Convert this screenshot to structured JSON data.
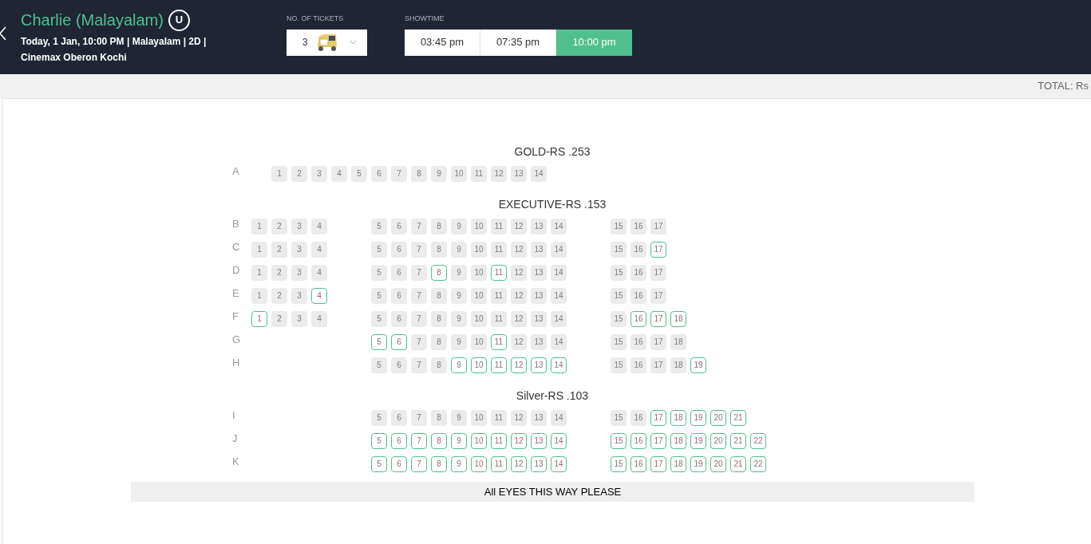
{
  "movie": {
    "title": "Charlie (Malayalam)",
    "rating": "U",
    "details": "Today, 1 Jan, 10:00 PM | Malayalam | 2D |",
    "venue": "Cinemax Oberon Kochi"
  },
  "tickets": {
    "label": "NO. OF TICKETS",
    "value": "3"
  },
  "showtimes": {
    "label": "SHOWTIME",
    "items": [
      {
        "time": "03:45 pm",
        "selected": false
      },
      {
        "time": "07:35 pm",
        "selected": false
      },
      {
        "time": "10:00 pm",
        "selected": true
      }
    ]
  },
  "total": {
    "label": "TOTAL: Rs"
  },
  "sections": [
    {
      "title": "GOLD-RS .253",
      "rows": [
        {
          "row": "A",
          "seats": [
            {
              "n": "1",
              "available": false
            },
            {
              "n": "2",
              "available": false
            },
            {
              "n": "3",
              "available": false
            },
            {
              "n": "4",
              "available": false
            },
            {
              "n": "5",
              "available": false
            },
            {
              "n": "6",
              "available": false
            },
            {
              "n": "7",
              "available": false
            },
            {
              "n": "8",
              "available": false
            },
            {
              "n": "9",
              "available": false
            },
            {
              "n": "10",
              "available": false
            },
            {
              "n": "11",
              "available": false
            },
            {
              "n": "12",
              "available": false
            },
            {
              "n": "13",
              "available": false
            },
            {
              "n": "14",
              "available": false
            }
          ]
        }
      ]
    },
    {
      "title": "EXECUTIVE-RS .153",
      "rows": [
        {
          "row": "B",
          "seats": [
            {
              "n": "1",
              "available": false
            },
            {
              "n": "2",
              "available": false
            },
            {
              "n": "3",
              "available": false
            },
            {
              "n": "4",
              "available": false
            },
            {
              "n": "5",
              "available": false
            },
            {
              "n": "6",
              "available": false
            },
            {
              "n": "7",
              "available": false
            },
            {
              "n": "8",
              "available": false
            },
            {
              "n": "9",
              "available": false
            },
            {
              "n": "10",
              "available": false
            },
            {
              "n": "11",
              "available": false
            },
            {
              "n": "12",
              "available": false
            },
            {
              "n": "13",
              "available": false
            },
            {
              "n": "14",
              "available": false
            },
            {
              "n": "15",
              "available": false
            },
            {
              "n": "16",
              "available": false
            },
            {
              "n": "17",
              "available": false
            }
          ]
        },
        {
          "row": "C",
          "seats": [
            {
              "n": "1",
              "available": false
            },
            {
              "n": "2",
              "available": false
            },
            {
              "n": "3",
              "available": false
            },
            {
              "n": "4",
              "available": false
            },
            {
              "n": "5",
              "available": false
            },
            {
              "n": "6",
              "available": false
            },
            {
              "n": "7",
              "available": false
            },
            {
              "n": "8",
              "available": false
            },
            {
              "n": "9",
              "available": false
            },
            {
              "n": "10",
              "available": false
            },
            {
              "n": "11",
              "available": false
            },
            {
              "n": "12",
              "available": false
            },
            {
              "n": "13",
              "available": false
            },
            {
              "n": "14",
              "available": false
            },
            {
              "n": "15",
              "available": false
            },
            {
              "n": "16",
              "available": false
            },
            {
              "n": "17",
              "available": true
            }
          ]
        },
        {
          "row": "D",
          "seats": [
            {
              "n": "1",
              "available": false
            },
            {
              "n": "2",
              "available": false
            },
            {
              "n": "3",
              "available": false
            },
            {
              "n": "4",
              "available": false
            },
            {
              "n": "5",
              "available": false
            },
            {
              "n": "6",
              "available": false
            },
            {
              "n": "7",
              "available": false
            },
            {
              "n": "8",
              "available": true
            },
            {
              "n": "9",
              "available": false
            },
            {
              "n": "10",
              "available": false
            },
            {
              "n": "11",
              "available": true
            },
            {
              "n": "12",
              "available": false
            },
            {
              "n": "13",
              "available": false
            },
            {
              "n": "14",
              "available": false
            },
            {
              "n": "15",
              "available": false
            },
            {
              "n": "16",
              "available": false
            },
            {
              "n": "17",
              "available": false
            }
          ]
        },
        {
          "row": "E",
          "seats": [
            {
              "n": "1",
              "available": false
            },
            {
              "n": "2",
              "available": false
            },
            {
              "n": "3",
              "available": false
            },
            {
              "n": "4",
              "available": true
            },
            {
              "n": "5",
              "available": false
            },
            {
              "n": "6",
              "available": false
            },
            {
              "n": "7",
              "available": false
            },
            {
              "n": "8",
              "available": false
            },
            {
              "n": "9",
              "available": false
            },
            {
              "n": "10",
              "available": false
            },
            {
              "n": "11",
              "available": false
            },
            {
              "n": "12",
              "available": false
            },
            {
              "n": "13",
              "available": false
            },
            {
              "n": "14",
              "available": false
            },
            {
              "n": "15",
              "available": false
            },
            {
              "n": "16",
              "available": false
            },
            {
              "n": "17",
              "available": false
            }
          ]
        },
        {
          "row": "F",
          "seats": [
            {
              "n": "1",
              "available": true
            },
            {
              "n": "2",
              "available": false
            },
            {
              "n": "3",
              "available": false
            },
            {
              "n": "4",
              "available": false
            },
            {
              "n": "5",
              "available": false
            },
            {
              "n": "6",
              "available": false
            },
            {
              "n": "7",
              "available": false
            },
            {
              "n": "8",
              "available": false
            },
            {
              "n": "9",
              "available": false
            },
            {
              "n": "10",
              "available": false
            },
            {
              "n": "11",
              "available": false
            },
            {
              "n": "12",
              "available": false
            },
            {
              "n": "13",
              "available": false
            },
            {
              "n": "14",
              "available": false
            },
            {
              "n": "15",
              "available": false
            },
            {
              "n": "16",
              "available": true
            },
            {
              "n": "17",
              "available": true
            },
            {
              "n": "18",
              "available": true
            }
          ]
        },
        {
          "row": "G",
          "seats": [
            {
              "n": "5",
              "available": true
            },
            {
              "n": "6",
              "available": true
            },
            {
              "n": "7",
              "available": false
            },
            {
              "n": "8",
              "available": false
            },
            {
              "n": "9",
              "available": false
            },
            {
              "n": "10",
              "available": false
            },
            {
              "n": "11",
              "available": true
            },
            {
              "n": "12",
              "available": false
            },
            {
              "n": "13",
              "available": false
            },
            {
              "n": "14",
              "available": false
            },
            {
              "n": "15",
              "available": false
            },
            {
              "n": "16",
              "available": false
            },
            {
              "n": "17",
              "available": false
            },
            {
              "n": "18",
              "available": false
            }
          ]
        },
        {
          "row": "H",
          "seats": [
            {
              "n": "5",
              "available": false
            },
            {
              "n": "6",
              "available": false
            },
            {
              "n": "7",
              "available": false
            },
            {
              "n": "8",
              "available": false
            },
            {
              "n": "9",
              "available": true
            },
            {
              "n": "10",
              "available": true
            },
            {
              "n": "11",
              "available": true
            },
            {
              "n": "12",
              "available": true
            },
            {
              "n": "13",
              "available": true
            },
            {
              "n": "14",
              "available": true
            },
            {
              "n": "15",
              "available": false
            },
            {
              "n": "16",
              "available": false
            },
            {
              "n": "17",
              "available": false
            },
            {
              "n": "18",
              "available": false
            },
            {
              "n": "19",
              "available": true
            }
          ]
        }
      ]
    },
    {
      "title": "Silver-RS .103",
      "rows": [
        {
          "row": "I",
          "seats": [
            {
              "n": "5",
              "available": false
            },
            {
              "n": "6",
              "available": false
            },
            {
              "n": "7",
              "available": false
            },
            {
              "n": "8",
              "available": false
            },
            {
              "n": "9",
              "available": false
            },
            {
              "n": "10",
              "available": false
            },
            {
              "n": "11",
              "available": false
            },
            {
              "n": "12",
              "available": false
            },
            {
              "n": "13",
              "available": false
            },
            {
              "n": "14",
              "available": false
            },
            {
              "n": "15",
              "available": false
            },
            {
              "n": "16",
              "available": false
            },
            {
              "n": "17",
              "available": true
            },
            {
              "n": "18",
              "available": true
            },
            {
              "n": "19",
              "available": true
            },
            {
              "n": "20",
              "available": true
            },
            {
              "n": "21",
              "available": true
            }
          ]
        },
        {
          "row": "J",
          "seats": [
            {
              "n": "5",
              "available": true
            },
            {
              "n": "6",
              "available": true
            },
            {
              "n": "7",
              "available": true
            },
            {
              "n": "8",
              "available": true
            },
            {
              "n": "9",
              "available": true
            },
            {
              "n": "10",
              "available": true
            },
            {
              "n": "11",
              "available": true
            },
            {
              "n": "12",
              "available": true
            },
            {
              "n": "13",
              "available": true
            },
            {
              "n": "14",
              "available": true
            },
            {
              "n": "15",
              "available": true
            },
            {
              "n": "16",
              "available": true
            },
            {
              "n": "17",
              "available": true
            },
            {
              "n": "18",
              "available": true
            },
            {
              "n": "19",
              "available": true
            },
            {
              "n": "20",
              "available": true
            },
            {
              "n": "21",
              "available": true
            },
            {
              "n": "22",
              "available": true
            }
          ]
        },
        {
          "row": "K",
          "seats": [
            {
              "n": "5",
              "available": true
            },
            {
              "n": "6",
              "available": true
            },
            {
              "n": "7",
              "available": true
            },
            {
              "n": "8",
              "available": true
            },
            {
              "n": "9",
              "available": true
            },
            {
              "n": "10",
              "available": true
            },
            {
              "n": "11",
              "available": true
            },
            {
              "n": "12",
              "available": true
            },
            {
              "n": "13",
              "available": true
            },
            {
              "n": "14",
              "available": true
            },
            {
              "n": "15",
              "available": true
            },
            {
              "n": "16",
              "available": true
            },
            {
              "n": "17",
              "available": true
            },
            {
              "n": "18",
              "available": true
            },
            {
              "n": "19",
              "available": true
            },
            {
              "n": "20",
              "available": true
            },
            {
              "n": "21",
              "available": true
            },
            {
              "n": "22",
              "available": true
            }
          ]
        }
      ]
    }
  ],
  "screen": {
    "label": "All EYES THIS WAY PLEASE"
  }
}
